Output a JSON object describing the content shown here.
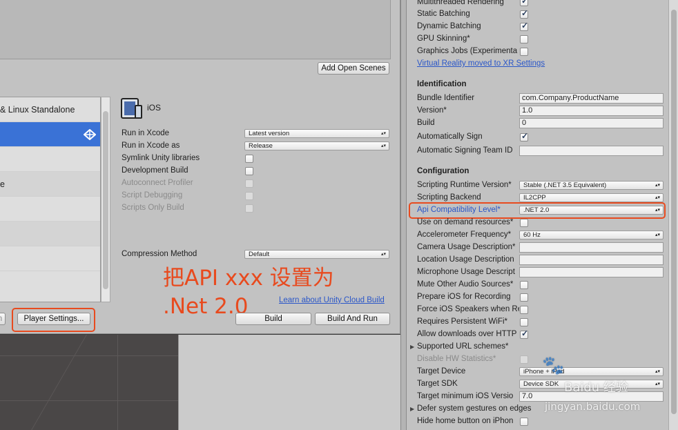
{
  "build": {
    "add_open_scenes": "Add Open Scenes",
    "platforms": [
      "& Linux Standalone",
      "",
      "",
      "e",
      "",
      "",
      ""
    ],
    "platform_title": "iOS",
    "rows": [
      {
        "label": "Run in Xcode",
        "value": "Latest version"
      },
      {
        "label": "Run in Xcode as",
        "value": "Release"
      },
      {
        "label": "Symlink Unity libraries"
      },
      {
        "label": "Development Build"
      },
      {
        "label": "Autoconnect Profiler"
      },
      {
        "label": "Script Debugging"
      },
      {
        "label": "Scripts Only Build"
      }
    ],
    "compression_label": "Compression Method",
    "compression_value": "Default",
    "cloud_link": "Learn about Unity Cloud Build",
    "player_settings": "Player Settings...",
    "build_btn": "Build",
    "build_run_btn": "Build And Run",
    "left_btn_fragment": "n"
  },
  "annotation": {
    "line1": "把API xxx 设置为",
    "line2": ".Net 2.0"
  },
  "inspector": {
    "top": {
      "multithreaded": "Multithreaded Rendering",
      "static_batching": "Static Batching",
      "dynamic_batching": "Dynamic Batching",
      "gpu_skinning": "GPU Skinning*",
      "graphics_jobs": "Graphics Jobs (Experimenta",
      "vr_link": "Virtual Reality moved to XR Settings"
    },
    "identification": {
      "header": "Identification",
      "bundle_label": "Bundle Identifier",
      "bundle_value": "com.Company.ProductName",
      "version_label": "Version*",
      "version_value": "1.0",
      "build_label": "Build",
      "build_value": "0",
      "auto_sign": "Automatically Sign",
      "team_id": "Automatic Signing Team ID"
    },
    "configuration": {
      "header": "Configuration",
      "runtime_label": "Scripting Runtime Version*",
      "runtime_value": "Stable (.NET 3.5 Equivalent)",
      "backend_label": "Scripting Backend",
      "backend_value": "IL2CPP",
      "api_label": "Api Compatibility Level*",
      "api_value": ".NET 2.0",
      "on_demand": "Use on demand resources*",
      "accel_label": "Accelerometer Frequency*",
      "accel_value": "60 Hz",
      "camera": "Camera Usage Description*",
      "location": "Location Usage Description",
      "microphone": "Microphone Usage Descript",
      "mute_audio": "Mute Other Audio Sources*",
      "prepare_ios": "Prepare iOS for Recording",
      "force_speakers": "Force iOS Speakers when Re",
      "requires_wifi": "Requires Persistent WiFi*",
      "allow_http": "Allow downloads over HTTP",
      "url_schemes": "Supported URL schemes*",
      "disable_hw": "Disable HW Statistics*",
      "target_device_label": "Target Device",
      "target_device_value": "iPhone + iPad",
      "target_sdk_label": "Target SDK",
      "target_sdk_value": "Device SDK",
      "min_ios_label": "Target minimum iOS Versio",
      "min_ios_value": "7.0",
      "defer_gestures": "Defer system gestures on edges",
      "hide_home": "Hide home button on iPhon"
    }
  },
  "watermark": {
    "brand": "Baidu 经验",
    "url": "jingyan.baidu.com"
  },
  "colors": {
    "highlight": "#e84a1e",
    "link": "#2a56c8",
    "selection": "#3a72d6"
  }
}
